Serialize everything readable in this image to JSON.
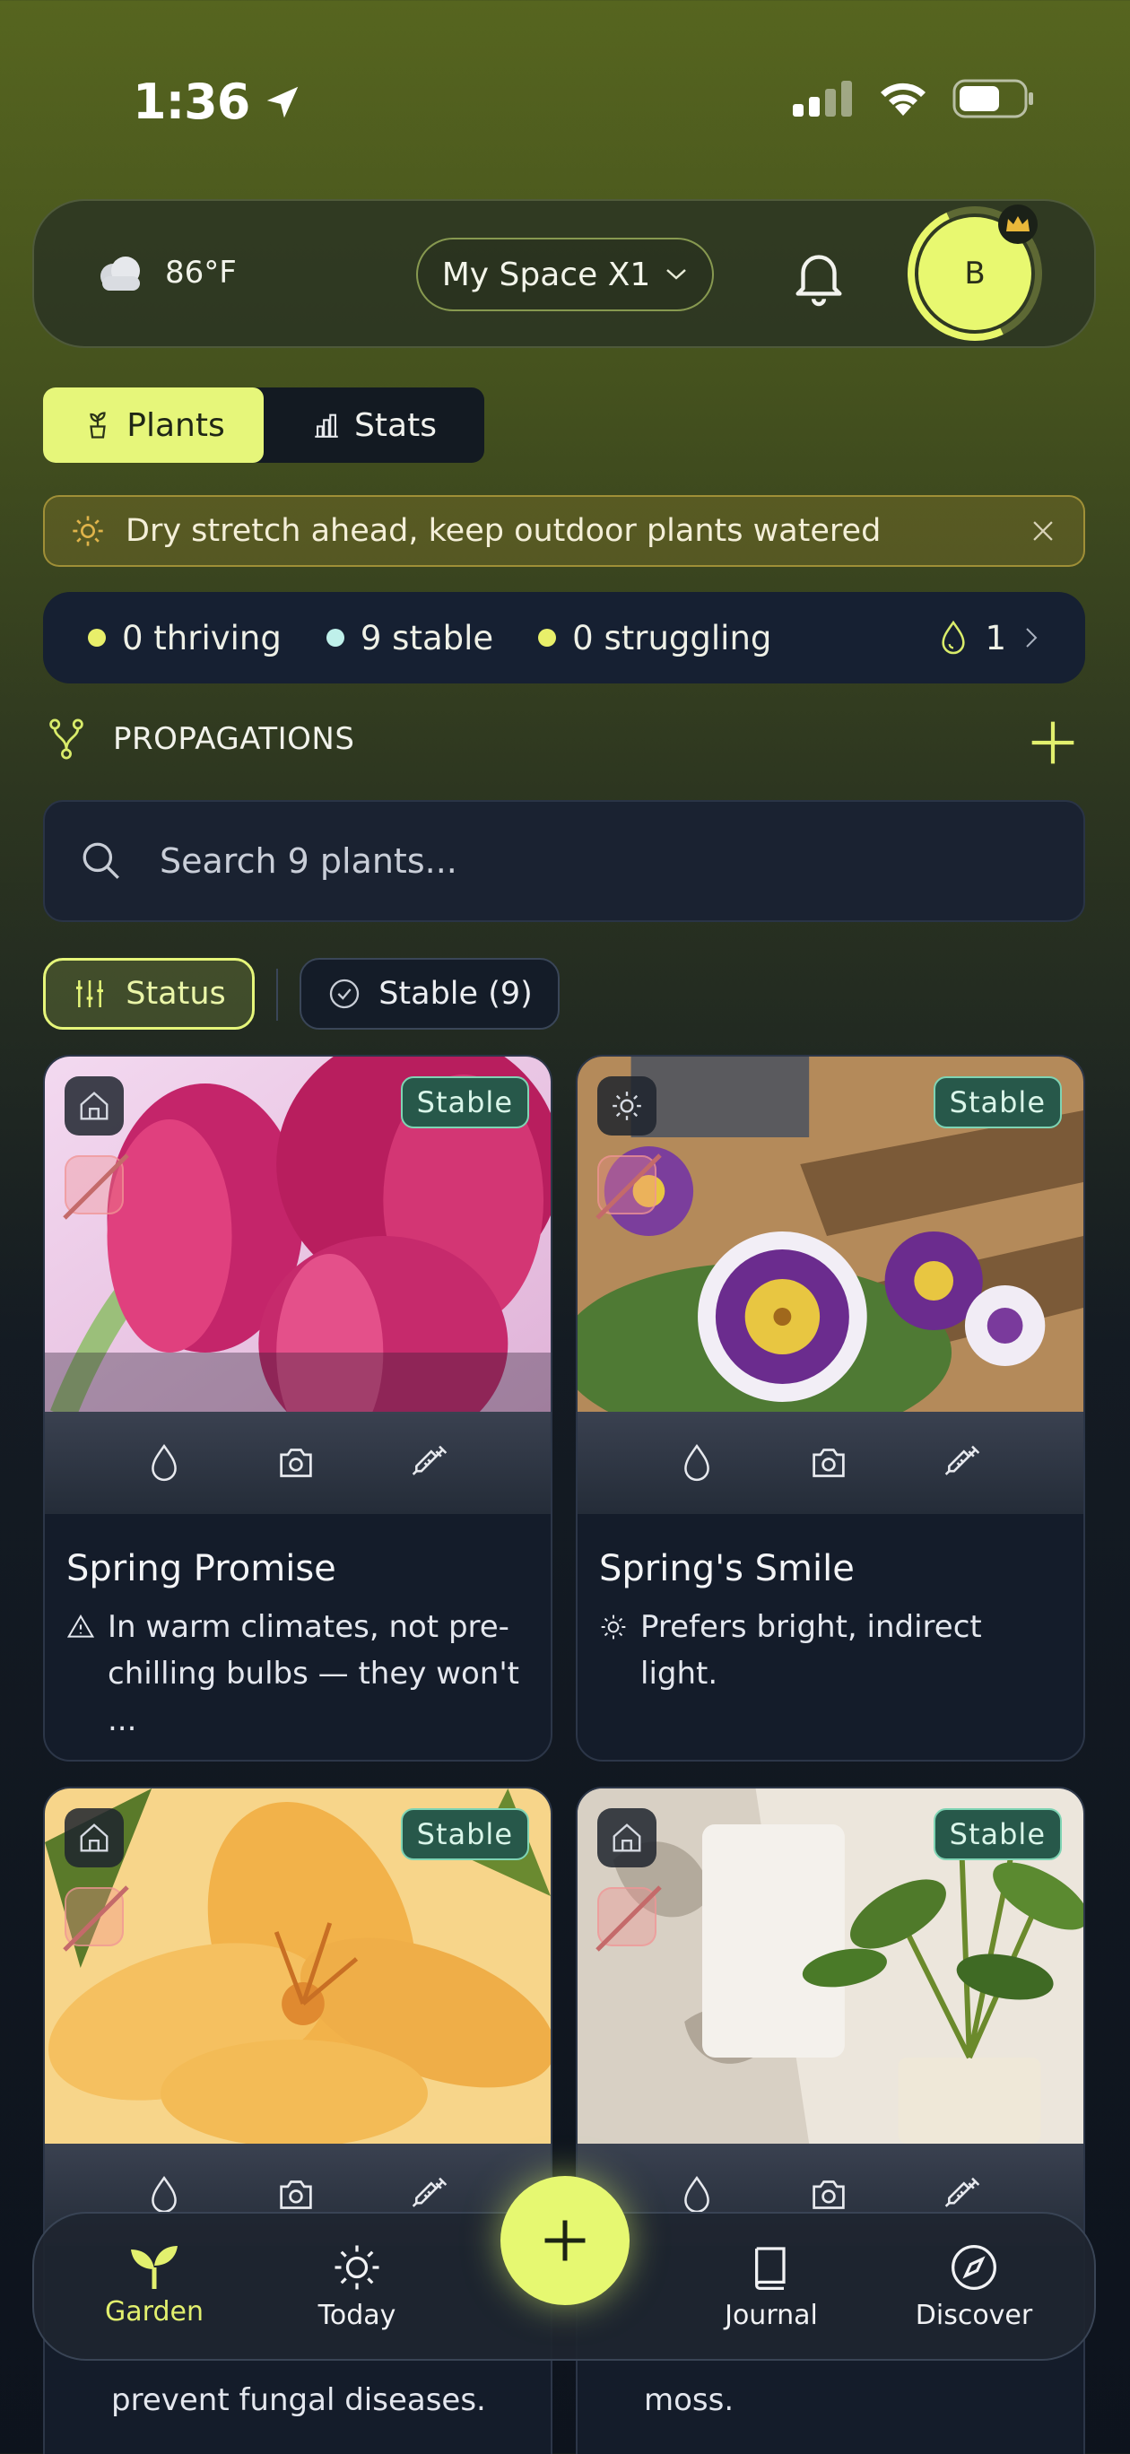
{
  "status_bar": {
    "time": "1:36"
  },
  "header": {
    "temperature": "86°F",
    "space_label": "My Space X1",
    "avatar_initial": "B"
  },
  "tabs": [
    {
      "label": "Plants",
      "active": true
    },
    {
      "label": "Stats",
      "active": false
    }
  ],
  "banner": {
    "message": "Dry stretch ahead, keep outdoor plants watered"
  },
  "counts": {
    "thriving": "0 thriving",
    "stable": "9 stable",
    "struggling": "0 struggling",
    "water": "1",
    "colors": {
      "thriving": "#e8ef6a",
      "stable": "#bff0ea",
      "struggling": "#e8ef6a"
    }
  },
  "propagations": {
    "label": "PROPAGATIONS"
  },
  "search": {
    "placeholder": "Search 9 plants..."
  },
  "filters": {
    "status": "Status",
    "stable": "Stable (9)"
  },
  "plants": [
    {
      "name": "Spring Promise",
      "status": "Stable",
      "location": "indoor",
      "note_icon": "warning-icon",
      "note": "In warm climates, not pre-chilling bulbs — they won't ..."
    },
    {
      "name": "Spring's Smile",
      "status": "Stable",
      "location": "outdoor",
      "note_icon": "sun-icon",
      "note": "Prefers bright, indirect light."
    },
    {
      "name": "",
      "status": "Stable",
      "location": "indoor",
      "note": "Good air circulation helps prevent fungal diseases."
    },
    {
      "name": "",
      "status": "Stable",
      "location": "indoor",
      "note": "Root in water or sphagnum moss."
    }
  ],
  "below_fold": {
    "card3_note_tail": "prevent fungal diseases.",
    "card4_note_tail": "moss."
  },
  "nav": {
    "garden": "Garden",
    "today": "Today",
    "journal": "Journal",
    "discover": "Discover"
  },
  "theme": {
    "accent": "#e6f67a",
    "badge": "#27584a"
  }
}
